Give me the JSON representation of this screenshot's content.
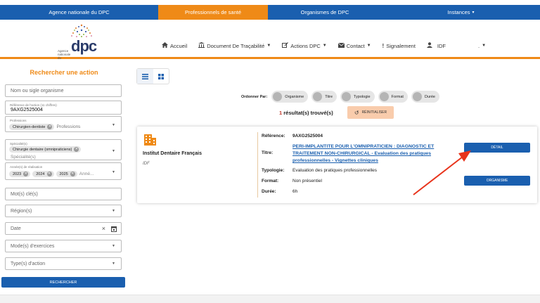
{
  "topnav": {
    "tabs": [
      {
        "label": "Agence nationale du DPC"
      },
      {
        "label": "Professionnels de santé"
      },
      {
        "label": "Organismes de DPC"
      },
      {
        "label": "Instances"
      }
    ],
    "instances_caret": "▾"
  },
  "logo": {
    "text": "dpc",
    "small": "Agence nationale du"
  },
  "menu": {
    "accueil": "Accueil",
    "tracabilite": "Document De Traçabilité",
    "actions": "Actions DPC",
    "contact": "Contact",
    "signalement": "Signalement",
    "user": "IDF",
    "extra": "."
  },
  "search": {
    "title": "Rechercher une action",
    "org_placeholder": "Nom ou sigle organisme",
    "ref_label": "Référence de l'action (11 chiffres)",
    "ref_value": "9AXG2525004",
    "professions_label": "Professions",
    "professions_chip": "Chirurgien-dentiste",
    "professions_placeholder": "Professions",
    "specialite_label": "Spécialité(s)",
    "specialite_chip": "Chirurgie dentaire (omnipraticiens)",
    "specialite_placeholder": "Spécialité(s)",
    "annees_label": "Année(s) de réalisation",
    "annees_chips": [
      "2023",
      "2024",
      "2025"
    ],
    "annees_placeholder": "Anné...",
    "motcle_placeholder": "Mot(s) clé(s)",
    "region_placeholder": "Région(s)",
    "date_placeholder": "Date",
    "mode_placeholder": "Mode(s) d'exercices",
    "type_placeholder": "Type(s) d'action",
    "search_button": "RECHERCHER"
  },
  "sort": {
    "label": "Ordonner Par:",
    "options": [
      "Organisme",
      "Titre",
      "Typologie",
      "Format",
      "Durée"
    ]
  },
  "results": {
    "count": "1",
    "text": "résultat(s) trouvé(s)",
    "reset_label": "RÉINITIALISER"
  },
  "card": {
    "org_name": "Institut Dentaire Français",
    "region": "IDF",
    "reference_label": "Référence:",
    "reference_value": "9AXG2525004",
    "titre_label": "Titre:",
    "titre_value": "PERI-IMPLANTITE POUR L'OMNIPRATICIEN : DIAGNOSTIC ET TRAITEMENT NON-CHIRURGICAL - Evaluation des pratiques professionnelles - Vignettes cliniques",
    "typologie_label": "Typologie:",
    "typologie_value": "Evaluation des pratiques professionnelles",
    "format_label": "Format:",
    "format_value": "Non présentiel",
    "duree_label": "Durée:",
    "duree_value": "6h",
    "detail_button": "DÉTAIL",
    "organisme_button": "ORGANISME"
  },
  "colors": {
    "brand_blue": "#1a5faf",
    "accent_orange": "#ef8a17",
    "annotation_red": "#e8341c"
  }
}
